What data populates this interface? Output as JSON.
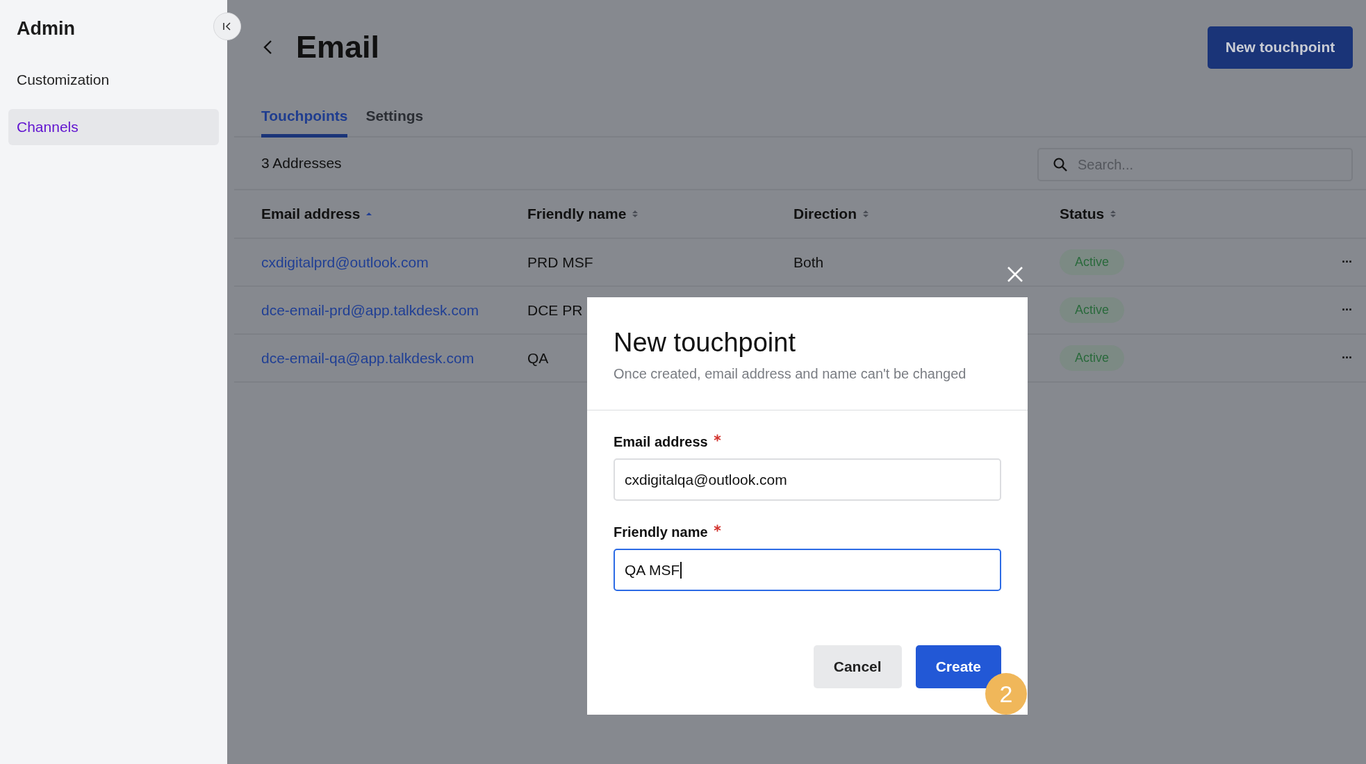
{
  "sidebar": {
    "title": "Admin",
    "items": [
      {
        "label": "Customization",
        "selected": false
      },
      {
        "label": "Channels",
        "selected": true
      }
    ]
  },
  "header": {
    "title": "Email",
    "button": "New touchpoint"
  },
  "tabs": [
    {
      "label": "Touchpoints",
      "selected": true
    },
    {
      "label": "Settings",
      "selected": false
    }
  ],
  "toolbar": {
    "count": "3 Addresses",
    "search": {
      "placeholder": "Search..."
    }
  },
  "table": {
    "columns": [
      {
        "label": "Email address",
        "sorted": true
      },
      {
        "label": "Friendly name",
        "sorted": false
      },
      {
        "label": "Direction",
        "sorted": false
      },
      {
        "label": "Status",
        "sorted": false
      }
    ],
    "rows": [
      {
        "email": "cxdigitalprd@outlook.com",
        "name": "PRD MSF",
        "direction": "Both",
        "status": "Active",
        "menu": "···"
      },
      {
        "email": "dce-email-prd@app.talkdesk.com",
        "name": "DCE PR",
        "status": "Active",
        "menu": "···"
      },
      {
        "email": "dce-email-qa@app.talkdesk.com",
        "name": "QA",
        "status": "Active",
        "menu": "···"
      }
    ]
  },
  "dialog": {
    "title": "New touchpoint",
    "subtitle": "Once created, email address and name can't be changed",
    "fields": [
      {
        "label": "Email address",
        "required": true,
        "value": "cxdigitalqa@outlook.com",
        "focused": false
      },
      {
        "label": "Friendly name",
        "required": true,
        "value": "QA MSF",
        "focused": true
      }
    ],
    "buttons": [
      {
        "label": "Cancel",
        "kind": "secondary"
      },
      {
        "label": "Create",
        "kind": "primary"
      }
    ],
    "step_badge": "2"
  }
}
